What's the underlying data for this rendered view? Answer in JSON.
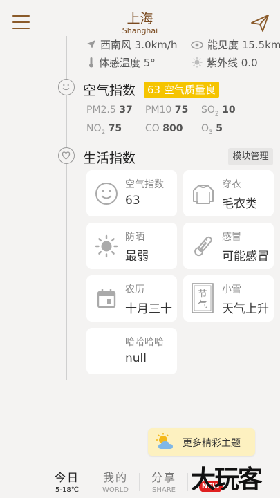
{
  "header": {
    "city": "上海",
    "city_en": "Shanghai"
  },
  "weather": {
    "wind": "西南风 3.0km/h",
    "visibility": "能见度 15.5km",
    "feels_like": "体感温度 5°",
    "uv": "紫外线 0.0"
  },
  "air": {
    "title": "空气指数",
    "badge": "63 空气质量良",
    "pm25_label": "PM2.5",
    "pm25": "37",
    "pm10_label": "PM10",
    "pm10": "75",
    "so2_label": "SO",
    "so2_sub": "2",
    "so2": "10",
    "no2_label": "NO",
    "no2_sub": "2",
    "no2": "75",
    "co_label": "CO",
    "co": "800",
    "o3_label": "O",
    "o3_sub": "3",
    "o3": "5"
  },
  "life": {
    "title": "生活指数",
    "manage": "模块管理",
    "cards": [
      {
        "label": "空气指数",
        "value": "63",
        "icon": "smiley-icon"
      },
      {
        "label": "穿衣",
        "value": "毛衣类",
        "icon": "sweater-icon"
      },
      {
        "label": "防晒",
        "value": "最弱",
        "icon": "sun-icon"
      },
      {
        "label": "感冒",
        "value": "可能感冒",
        "icon": "thermometer-icon"
      },
      {
        "label": "农历",
        "value": "十月三十",
        "icon": "calendar-icon"
      },
      {
        "label": "小雪",
        "value": "天气上升",
        "icon": "solar-term-icon",
        "icon_text": "节气"
      },
      {
        "label": "哈哈哈哈",
        "value": "null",
        "icon": "none"
      }
    ]
  },
  "banner": {
    "text": "更多精彩主题",
    "icon": "sun-cloud-icon"
  },
  "tabs": [
    {
      "label": "今日",
      "sub": "5-18℃"
    },
    {
      "label": "我的",
      "sub": "WORLD"
    },
    {
      "label": "分享",
      "sub": "SHARE"
    },
    {
      "label": "",
      "sub": ""
    }
  ],
  "new_badge": "NEW",
  "watermark": "大玩客"
}
